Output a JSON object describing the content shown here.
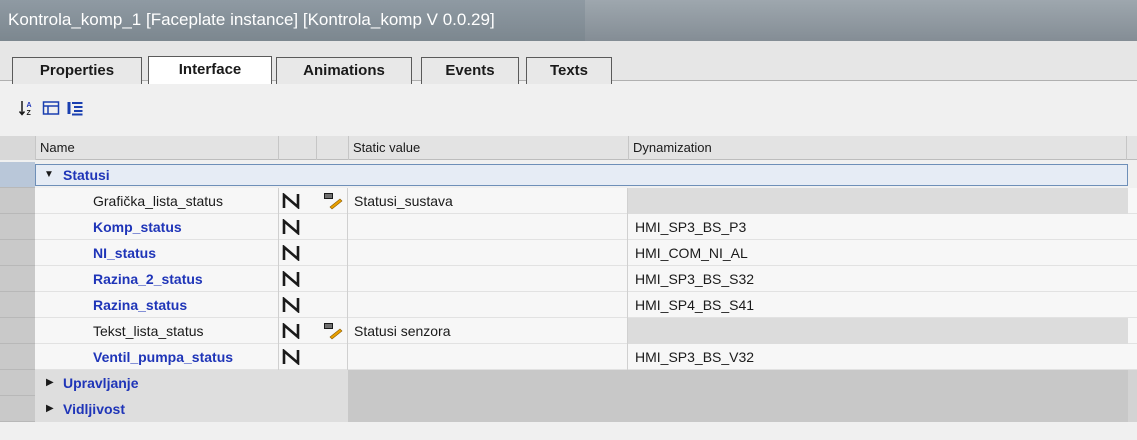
{
  "window": {
    "title": "Kontrola_komp_1 [Faceplate instance] [Kontrola_komp V 0.0.29]"
  },
  "tabs": [
    {
      "label": "Properties",
      "active": false
    },
    {
      "label": "Interface",
      "active": true
    },
    {
      "label": "Animations",
      "active": false
    },
    {
      "label": "Events",
      "active": false
    },
    {
      "label": "Texts",
      "active": false
    }
  ],
  "toolbar": {
    "icons": [
      "sort-az-icon",
      "collapse-all-icon",
      "expand-all-icon"
    ]
  },
  "table": {
    "columns": {
      "name": "Name",
      "static_value": "Static value",
      "dynamization": "Dynamization"
    },
    "groups": [
      {
        "label": "Statusi",
        "expanded": true,
        "rows": [
          {
            "name": "Grafička_lista_status",
            "style": "plain",
            "has_text_icon": true,
            "static_value": "Statusi_sustava",
            "dynamization": ""
          },
          {
            "name": "Komp_status",
            "style": "blue",
            "has_text_icon": false,
            "static_value": "",
            "dynamization": "HMI_SP3_BS_P3"
          },
          {
            "name": "NI_status",
            "style": "blue",
            "has_text_icon": false,
            "static_value": "",
            "dynamization": "HMI_COM_NI_AL"
          },
          {
            "name": "Razina_2_status",
            "style": "blue",
            "has_text_icon": false,
            "static_value": "",
            "dynamization": "HMI_SP3_BS_S32"
          },
          {
            "name": "Razina_status",
            "style": "blue",
            "has_text_icon": false,
            "static_value": "",
            "dynamization": "HMI_SP4_BS_S41"
          },
          {
            "name": "Tekst_lista_status",
            "style": "plain",
            "has_text_icon": true,
            "static_value": "Statusi senzora",
            "dynamization": ""
          },
          {
            "name": "Ventil_pumpa_status",
            "style": "blue",
            "has_text_icon": false,
            "static_value": "",
            "dynamization": "HMI_SP3_BS_V32"
          }
        ]
      },
      {
        "label": "Upravljanje",
        "expanded": false
      },
      {
        "label": "Vidljivost",
        "expanded": false
      }
    ]
  },
  "colors": {
    "accent_blue": "#1f35b8",
    "title_bar": "#8f9aa3"
  }
}
